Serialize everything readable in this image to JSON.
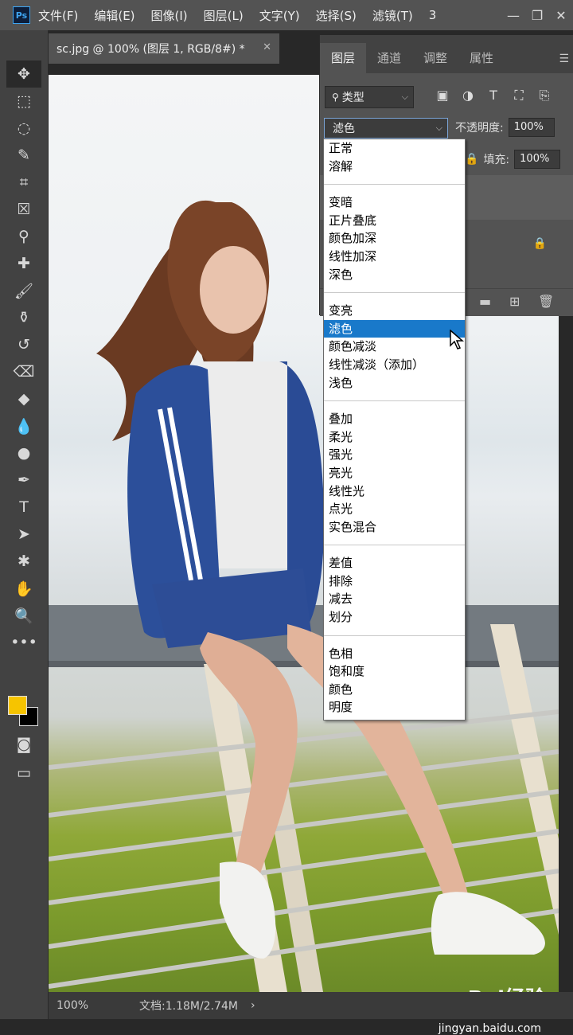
{
  "app": {
    "logo": "Ps"
  },
  "menubar": {
    "items": [
      "文件(F)",
      "编辑(E)",
      "图像(I)",
      "图层(L)",
      "文字(Y)",
      "选择(S)",
      "滤镜(T)",
      "3"
    ]
  },
  "window_controls": [
    "minimize",
    "restore",
    "close"
  ],
  "toolbar": {
    "tools": [
      "move-icon",
      "marquee-icon",
      "lasso-icon",
      "quick-select-icon",
      "crop-icon",
      "frame-icon",
      "eyedropper-icon",
      "healing-icon",
      "brush-icon",
      "clone-stamp-icon",
      "history-brush-icon",
      "eraser-icon",
      "paint-bucket-icon",
      "blur-icon",
      "dodge-icon",
      "pen-icon",
      "type-icon",
      "path-select-icon",
      "shape-icon",
      "hand-icon",
      "zoom-icon",
      "more-icon"
    ]
  },
  "colors": {
    "foreground": "#f6c400",
    "background": "#000000",
    "accent": "#1979ca"
  },
  "document": {
    "tab_title": "sc.jpg @ 100% (图层 1, RGB/8#) *"
  },
  "statusbar": {
    "zoom": "100%",
    "doc_info": "文档:1.18M/2.74M"
  },
  "watermark": {
    "brand": "Bai经验",
    "url": "jingyan.baidu.com"
  },
  "layers_panel": {
    "tabs": [
      "图层",
      "通道",
      "调整",
      "属性"
    ],
    "active_tab": "图层",
    "filter_label": "类型",
    "blend_mode": "滤色",
    "opacity_label": "不透明度:",
    "opacity_value": "100%",
    "fill_label": "填充:",
    "fill_value": "100%"
  },
  "blend_dropdown": {
    "groups": [
      [
        "正常",
        "溶解"
      ],
      [
        "变暗",
        "正片叠底",
        "颜色加深",
        "线性加深",
        "深色"
      ],
      [
        "变亮",
        "滤色",
        "颜色减淡",
        "线性减淡（添加）",
        "浅色"
      ],
      [
        "叠加",
        "柔光",
        "强光",
        "亮光",
        "线性光",
        "点光",
        "实色混合"
      ],
      [
        "差值",
        "排除",
        "减去",
        "划分"
      ],
      [
        "色相",
        "饱和度",
        "颜色",
        "明度"
      ]
    ],
    "selected": "滤色"
  }
}
